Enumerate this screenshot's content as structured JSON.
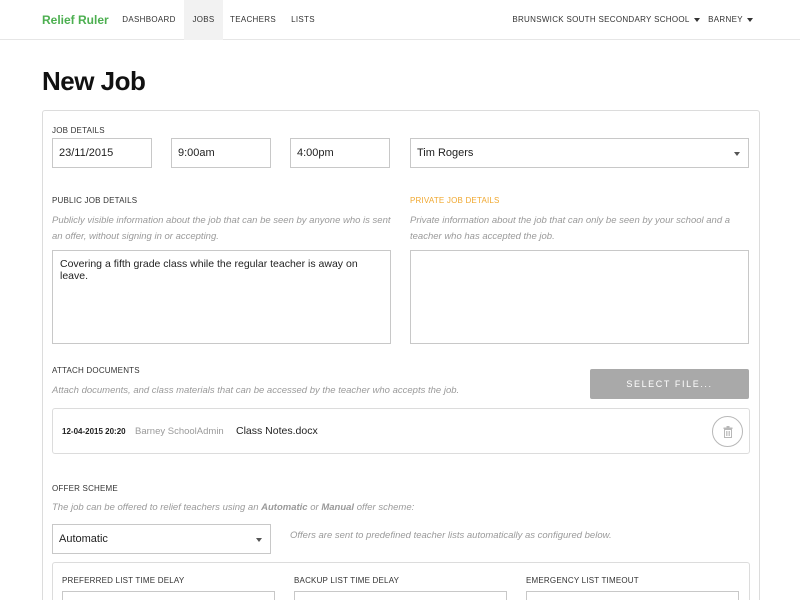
{
  "navbar": {
    "brand": "Relief Ruler",
    "items": [
      {
        "label": "DASHBOARD"
      },
      {
        "label": "JOBS"
      },
      {
        "label": "TEACHERS"
      },
      {
        "label": "LISTS"
      }
    ],
    "school": "BRUNSWICK SOUTH SECONDARY SCHOOL",
    "user": "BARNEY"
  },
  "page": {
    "title": "New Job"
  },
  "job_details": {
    "label": "JOB DETAILS",
    "date": "23/11/2015",
    "start_time": "9:00am",
    "end_time": "4:00pm",
    "teacher": "Tim Rogers"
  },
  "public_details": {
    "label": "PUBLIC JOB DETAILS",
    "help": "Publicly visible information about the job that can be seen by anyone who is sent an offer, without signing in or accepting.",
    "value": "Covering a fifth grade class while the regular teacher is away on leave."
  },
  "private_details": {
    "label": "PRIVATE JOB DETAILS",
    "help": "Private information about the job that can only be seen by your school and a teacher who has accepted the job.",
    "value": "",
    "label_color": "#f0a830"
  },
  "attach": {
    "label": "ATTACH DOCUMENTS",
    "help": "Attach documents, and class materials that can be accessed by the teacher who accepts the job.",
    "button": "SELECT FILE...",
    "documents": [
      {
        "date": "12-04-2015 20:20",
        "user": "Barney SchoolAdmin",
        "name": "Class Notes.docx"
      }
    ]
  },
  "offer_scheme": {
    "label": "OFFER SCHEME",
    "help_pre": "The job can be offered to relief teachers using an ",
    "help_auto": "Automatic",
    "help_mid": " or ",
    "help_manual": "Manual",
    "help_post": " offer scheme:",
    "selected": "Automatic",
    "note": "Offers are sent to predefined teacher lists automatically as configured below."
  },
  "list_settings": {
    "preferred": "PREFERRED LIST TIME DELAY",
    "backup": "BACKUP LIST TIME DELAY",
    "emergency": "EMERGENCY LIST TIMEOUT"
  },
  "colors": {
    "brand": "#4caf50",
    "accent_orange": "#f0a830",
    "button_gray": "#a9a9a9"
  }
}
